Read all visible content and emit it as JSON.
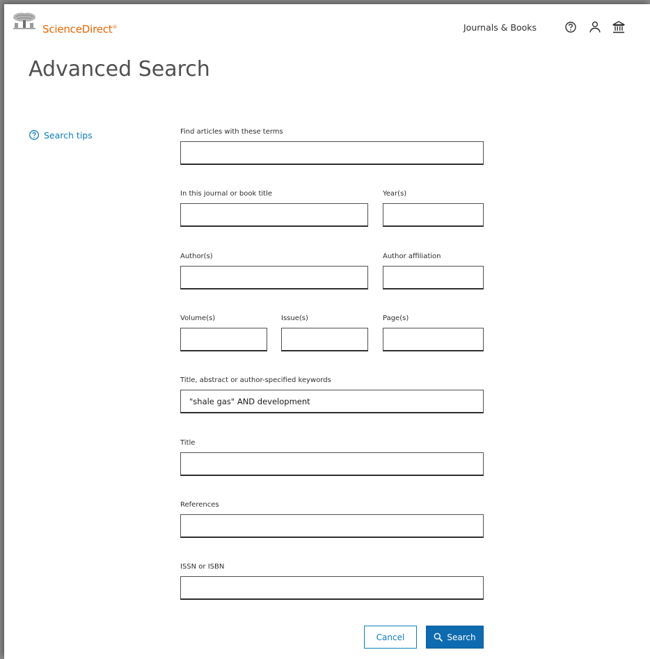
{
  "header": {
    "brand": "ScienceDirect",
    "brand_mark": "®",
    "nav_link": "Journals & Books",
    "icons": [
      "help-icon",
      "user-icon",
      "institution-icon"
    ]
  },
  "page": {
    "title": "Advanced Search",
    "search_tips": "Search tips"
  },
  "form": {
    "terms": {
      "label": "Find articles with these terms",
      "value": ""
    },
    "journal": {
      "label": "In this journal or book title",
      "value": ""
    },
    "years": {
      "label": "Year(s)",
      "value": ""
    },
    "authors": {
      "label": "Author(s)",
      "value": ""
    },
    "affiliation": {
      "label": "Author affiliation",
      "value": ""
    },
    "volume": {
      "label": "Volume(s)",
      "value": ""
    },
    "issue": {
      "label": "Issue(s)",
      "value": ""
    },
    "pages": {
      "label": "Page(s)",
      "value": ""
    },
    "keywords": {
      "label": "Title, abstract or author-specified keywords",
      "value": "\"shale gas\" AND development"
    },
    "title": {
      "label": "Title",
      "value": ""
    },
    "references": {
      "label": "References",
      "value": ""
    },
    "issn": {
      "label": "ISSN or ISBN",
      "value": ""
    }
  },
  "actions": {
    "cancel": "Cancel",
    "search": "Search"
  },
  "colors": {
    "brand": "#eb6500",
    "link": "#0c7dbb",
    "primary_button": "#0f6bb0"
  }
}
